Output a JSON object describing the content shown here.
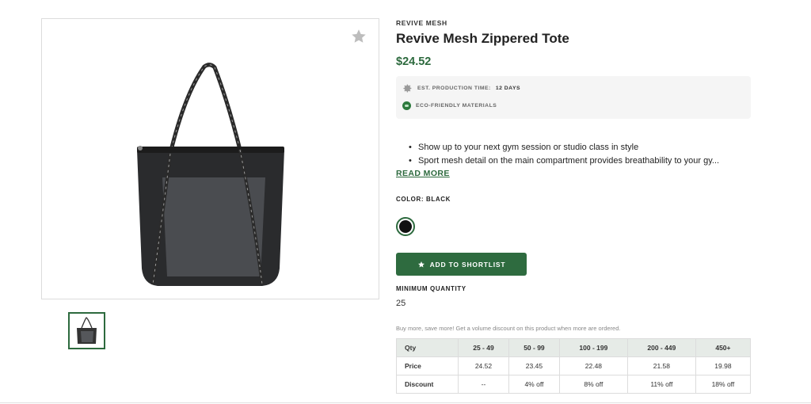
{
  "product": {
    "brand": "REVIVE MESH",
    "title": "Revive Mesh Zippered Tote",
    "price": "$24.52",
    "image_icon": "tote-bag-image",
    "favorite_icon": "star-icon"
  },
  "info": {
    "production_label": "EST. PRODUCTION TIME:",
    "production_value": "12 DAYS",
    "eco_label": "ECO-FRIENDLY MATERIALS",
    "eco_badge_text": "ECO"
  },
  "description": {
    "bullets": [
      "Show up to your next gym session or studio class in style",
      "Sport mesh detail on the main compartment provides breathability to your gy..."
    ],
    "read_more": "READ MORE"
  },
  "color": {
    "label": "COLOR: BLACK",
    "selected_hex": "#111111"
  },
  "actions": {
    "shortlist_label": "ADD TO SHORTLIST"
  },
  "minimum": {
    "label": "MINIMUM QUANTITY",
    "value": "25"
  },
  "volume": {
    "note": "Buy more, save more! Get a volume discount on this product when more are ordered.",
    "headers": [
      "Qty",
      "25 - 49",
      "50 - 99",
      "100 - 199",
      "200 - 449",
      "450+"
    ],
    "price_row": [
      "Price",
      "24.52",
      "23.45",
      "22.48",
      "21.58",
      "19.98"
    ],
    "discount_row": [
      "Discount",
      "--",
      "4% off",
      "8% off",
      "11% off",
      "18% off"
    ]
  },
  "colors": {
    "accent": "#2d6a3e",
    "table_header_bg": "#e6ebe7",
    "info_bg": "#f5f5f5"
  }
}
